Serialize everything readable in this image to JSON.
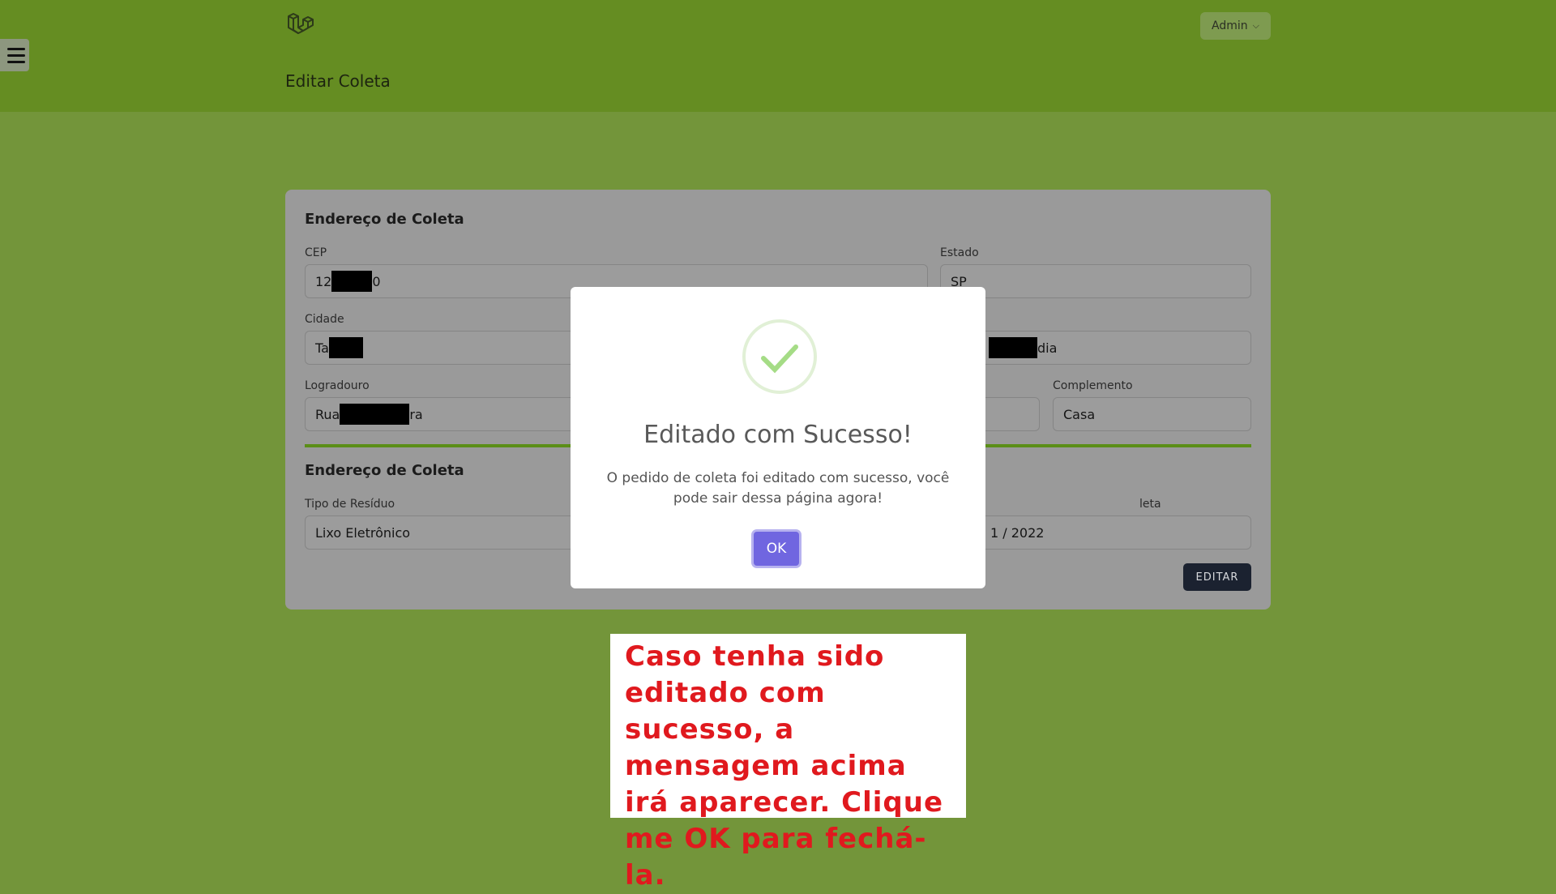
{
  "header": {
    "logo_icon": "laravel-logo-icon",
    "title": "Editar Coleta",
    "user_menu_label": "Admin",
    "user_menu_icon": "chevron-down-icon",
    "menu_toggle_icon": "hamburger-menu-icon"
  },
  "form": {
    "section1_title": "Endereço de Coleta",
    "cep": {
      "label": "CEP",
      "prefix": "12",
      "suffix": "0"
    },
    "estado": {
      "label": "Estado",
      "value": "SP"
    },
    "cidade": {
      "label": "Cidade",
      "prefix": "Ta"
    },
    "bairro": {
      "suffix": "dia"
    },
    "logradouro": {
      "label": "Logradouro",
      "prefix": "Rua",
      "suffix": "ra"
    },
    "complemento": {
      "label": "Complemento",
      "value": "Casa"
    },
    "section2_title": "Endereço de Coleta",
    "tipo_residuo": {
      "label": "Tipo de Resíduo",
      "value": "Lixo Eletrônico"
    },
    "data_coleta": {
      "label_fragment": "leta",
      "value_fragment": "1 / 2022"
    },
    "submit_label": "EDITAR"
  },
  "modal": {
    "icon": "success-check-icon",
    "title": "Editado com Sucesso!",
    "message": "O pedido de coleta foi editado com sucesso, você pode sair dessa página agora!",
    "ok_label": "OK",
    "accent_color": "#7066e0"
  },
  "annotation": {
    "text": "Caso tenha sido editado com sucesso, a mensagem acima irá aparecer. Clique me OK para fechá-la.",
    "color": "#e0191e"
  },
  "colors": {
    "background": "#73953a",
    "header": "#658d22"
  }
}
